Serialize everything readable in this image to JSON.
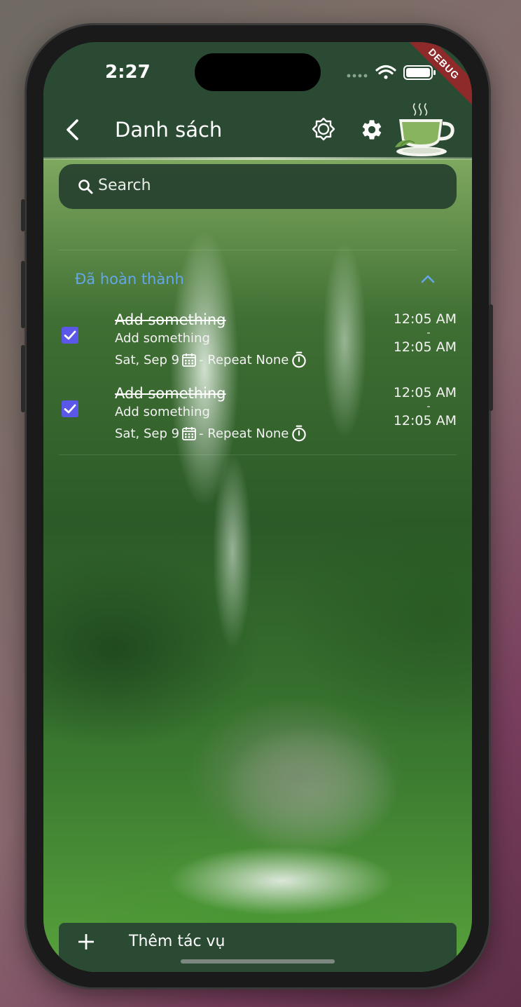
{
  "status_bar": {
    "time": "2:27",
    "debug_label": "DEBUG"
  },
  "header": {
    "title": "Danh sách",
    "icons": [
      "back-arrow-icon",
      "brightness-icon",
      "gear-icon",
      "tea-cup-logo"
    ]
  },
  "search": {
    "placeholder": "Search"
  },
  "section": {
    "title": "Đã hoàn thành",
    "title_color": "#64a6ea",
    "expanded": true
  },
  "tasks": [
    {
      "title": "Add something",
      "description": "Add something",
      "date": "Sat, Sep 9",
      "repeat": " - Repeat None",
      "start_time": "12:05 AM",
      "separator": "-",
      "end_time": "12:05 AM",
      "completed": true
    },
    {
      "title": "Add something",
      "description": "Add something",
      "date": "Sat, Sep 9",
      "repeat": " - Repeat None",
      "start_time": "12:05 AM",
      "separator": "-",
      "end_time": "12:05 AM",
      "completed": true
    }
  ],
  "footer": {
    "add_task_label": "Thêm tác vụ"
  },
  "colors": {
    "appbar": "#2b4a33",
    "checkbox": "#5b57e8",
    "accent_link": "#64a6ea"
  }
}
